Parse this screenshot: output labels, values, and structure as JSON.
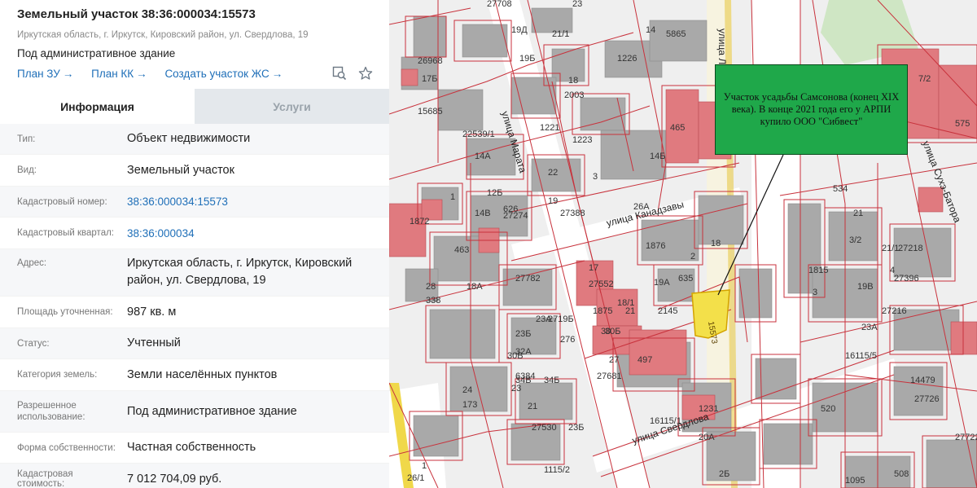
{
  "panel": {
    "title": "Земельный участок 38:36:000034:15573",
    "address_line": "Иркутская область, г. Иркутск, Кировский район, ул. Свердлова, 19",
    "description": "Под административное здание",
    "links": [
      "План ЗУ",
      "План КК",
      "Создать участок ЖС"
    ],
    "link_arrow": "→",
    "icons": [
      "search-map-icon",
      "star-icon"
    ],
    "tabs": [
      {
        "label": "Информация",
        "active": true
      },
      {
        "label": "Услуги",
        "active": false
      }
    ],
    "rows": [
      {
        "label": "Тип:",
        "value": "Объект недвижимости"
      },
      {
        "label": "Вид:",
        "value": "Земельный участок"
      },
      {
        "label": "Кадастровый номер:",
        "value": "38:36:000034:15573"
      },
      {
        "label": "Кадастровый квартал:",
        "value": "38:36:000034"
      },
      {
        "label": "Адрес:",
        "value": "Иркутская область, г. Иркутск, Кировский район, ул. Свердлова, 19"
      },
      {
        "label": "Площадь уточненная:",
        "value": "987 кв. м"
      },
      {
        "label": "Статус:",
        "value": "Учтенный"
      },
      {
        "label": "Категория земель:",
        "value": "Земли населённых пунктов"
      },
      {
        "label": "Разрешенное использование:",
        "value": "Под административное здание"
      },
      {
        "label": "Форма собственности:",
        "value": "Частная собственность"
      },
      {
        "label": "Кадастровая стоимость:",
        "value": "7 012 704,09 руб."
      }
    ],
    "colors": {
      "link": "#1f6fb8",
      "tab_inactive": "#e4e8ec"
    }
  },
  "map": {
    "callout_text": "Участок усадьбы Самсонова (конец XIX века). В конце 2021 года его у АРПИ купило ООО \"Сибвест\"",
    "streets": [
      "улица Марата",
      "улица Канадзавы",
      "улица Свердлова",
      "улица Сухэ-Батора",
      "улица Ле"
    ],
    "parcel_labels": [
      "27708",
      "21/1",
      "19Д",
      "23",
      "19Б",
      "1226",
      "5865",
      "14",
      "26968",
      "17Б",
      "15685",
      "18",
      "2003",
      "1221",
      "1223",
      "465",
      "22539/1",
      "14А",
      "14Б",
      "3",
      "1",
      "12Б",
      "22",
      "19",
      "27388",
      "1872",
      "626",
      "14В",
      "27274",
      "26А",
      "18",
      "1876",
      "2",
      "463",
      "18А",
      "27782",
      "28",
      "338",
      "17",
      "27552",
      "19А",
      "635",
      "1875",
      "18/1",
      "21",
      "2145",
      "23А",
      "2719Б",
      "30",
      "276",
      "23Б",
      "32А",
      "30В",
      "30Б",
      "27",
      "497",
      "6384",
      "34В",
      "34Б",
      "27681",
      "24",
      "173",
      "23",
      "21",
      "23Б",
      "27530",
      "1231",
      "20А",
      "1115/2",
      "16115/1",
      "2Б",
      "534",
      "21",
      "3/2",
      "21/1",
      "27218",
      "1815",
      "27396",
      "3",
      "19В",
      "4",
      "27216",
      "23А",
      "16115/5",
      "14479",
      "520",
      "1095",
      "27726",
      "508",
      "575",
      "27722",
      "26/1",
      "1",
      "7/2"
    ],
    "highlight_label": "15573",
    "colors": {
      "parcel_line": "#c8323c",
      "building": "#a9a9a9",
      "highlight": "#f3e04a",
      "callout_bg": "#1fa84a"
    }
  }
}
